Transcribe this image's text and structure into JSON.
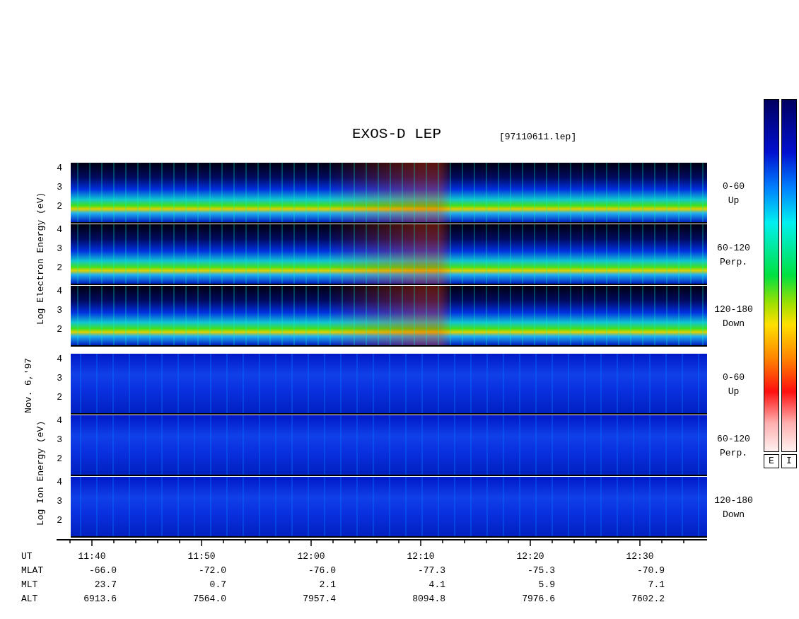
{
  "title": "EXOS-D LEP",
  "file": "[97110611.lep]",
  "date": "Nov. 6,'97",
  "groups": [
    {
      "kind": "electron",
      "axis_label": "Log Electron Energy (eV)",
      "panels": [
        {
          "yticks": [
            "4",
            "3",
            "2"
          ],
          "label": "0-60",
          "direction": "Up"
        },
        {
          "yticks": [
            "4",
            "3",
            "2"
          ],
          "label": "60-120",
          "direction": "Perp."
        },
        {
          "yticks": [
            "4",
            "3",
            "2"
          ],
          "label": "120-180",
          "direction": "Down"
        }
      ]
    },
    {
      "kind": "ion",
      "axis_label": "Log Ion Energy (eV)",
      "panels": [
        {
          "yticks": [
            "4",
            "3",
            "2"
          ],
          "label": "0-60",
          "direction": "Up"
        },
        {
          "yticks": [
            "4",
            "3",
            "2"
          ],
          "label": "60-120",
          "direction": "Perp."
        },
        {
          "yticks": [
            "4",
            "3",
            "2"
          ],
          "label": "120-180",
          "direction": "Down"
        }
      ]
    }
  ],
  "colorbars": [
    {
      "label": "E"
    },
    {
      "label": "I"
    }
  ],
  "time_label": "UT",
  "times": [
    "11:40",
    "11:50",
    "12:00",
    "12:10",
    "12:20",
    "12:30"
  ],
  "rows": [
    {
      "name": "MLAT",
      "values": [
        "-66.0",
        "-72.0",
        "-76.0",
        "-77.3",
        "-75.3",
        "-70.9"
      ]
    },
    {
      "name": "MLT",
      "values": [
        "23.7",
        "0.7",
        "2.1",
        "4.1",
        "5.9",
        "7.1"
      ]
    },
    {
      "name": "ALT",
      "values": [
        "6913.6",
        "7564.0",
        "7957.4",
        "8094.8",
        "7976.6",
        "7602.2"
      ]
    }
  ]
}
